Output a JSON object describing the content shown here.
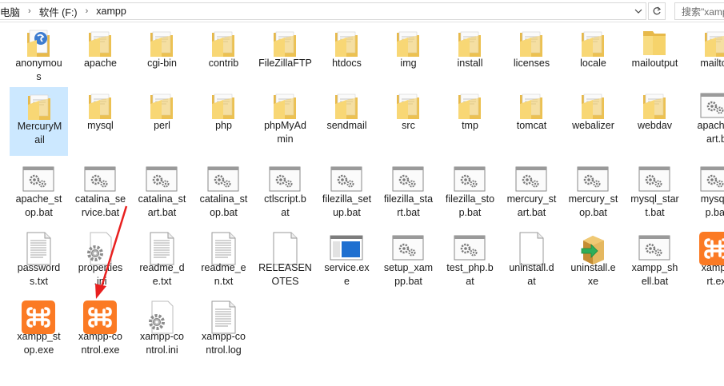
{
  "breadcrumb": [
    "电脑",
    "软件 (F:)",
    "xampp"
  ],
  "search": {
    "placeholder": "搜索\"xampp\""
  },
  "files": [
    {
      "name": "anonymous",
      "label": "anonymou\ns",
      "icon": "folder-simplenote",
      "col": 0,
      "row": 0
    },
    {
      "name": "apache",
      "label": "apache",
      "icon": "folder-docs",
      "col": 1,
      "row": 0
    },
    {
      "name": "cgi-bin",
      "label": "cgi-bin",
      "icon": "folder-docs",
      "col": 2,
      "row": 0
    },
    {
      "name": "contrib",
      "label": "contrib",
      "icon": "folder-docs",
      "col": 3,
      "row": 0
    },
    {
      "name": "FileZillaFTP",
      "label": "FileZillaFTP",
      "icon": "folder-docs",
      "col": 4,
      "row": 0
    },
    {
      "name": "htdocs",
      "label": "htdocs",
      "icon": "folder-docs",
      "col": 5,
      "row": 0
    },
    {
      "name": "img",
      "label": "img",
      "icon": "folder-docs",
      "col": 6,
      "row": 0
    },
    {
      "name": "install",
      "label": "install",
      "icon": "folder-docs",
      "col": 7,
      "row": 0
    },
    {
      "name": "licenses",
      "label": "licenses",
      "icon": "folder-docs",
      "col": 8,
      "row": 0
    },
    {
      "name": "locale",
      "label": "locale",
      "icon": "folder-docs",
      "col": 9,
      "row": 0
    },
    {
      "name": "mailoutput",
      "label": "mailoutput",
      "icon": "folder-empty",
      "col": 10,
      "row": 0
    },
    {
      "name": "mailtodisk",
      "label": "mailtod",
      "icon": "folder-docs",
      "col": 11,
      "row": 0
    },
    {
      "name": "MercuryMail",
      "label": "MercuryM\nail",
      "icon": "folder-docs",
      "col": 0,
      "row": 1,
      "selected": true
    },
    {
      "name": "mysql",
      "label": "mysql",
      "icon": "folder-docs",
      "col": 1,
      "row": 1
    },
    {
      "name": "perl",
      "label": "perl",
      "icon": "folder-docs",
      "col": 2,
      "row": 1
    },
    {
      "name": "php",
      "label": "php",
      "icon": "folder-docs",
      "col": 3,
      "row": 1
    },
    {
      "name": "phpMyAdmin",
      "label": "phpMyAd\nmin",
      "icon": "folder-docs",
      "col": 4,
      "row": 1
    },
    {
      "name": "sendmail",
      "label": "sendmail",
      "icon": "folder-docs",
      "col": 5,
      "row": 1
    },
    {
      "name": "src",
      "label": "src",
      "icon": "folder-docs",
      "col": 6,
      "row": 1
    },
    {
      "name": "tmp",
      "label": "tmp",
      "icon": "folder-docs",
      "col": 7,
      "row": 1
    },
    {
      "name": "tomcat",
      "label": "tomcat",
      "icon": "folder-docs",
      "col": 8,
      "row": 1
    },
    {
      "name": "webalizer",
      "label": "webalizer",
      "icon": "folder-docs",
      "col": 9,
      "row": 1
    },
    {
      "name": "webdav",
      "label": "webdav",
      "icon": "folder-docs",
      "col": 10,
      "row": 1
    },
    {
      "name": "apache_start.bat",
      "label": "apache_\nart.b",
      "icon": "bat",
      "col": 11,
      "row": 1
    },
    {
      "name": "apache_stop.bat",
      "label": "apache_st\nop.bat",
      "icon": "bat",
      "col": 0,
      "row": 2
    },
    {
      "name": "catalina_service.bat",
      "label": "catalina_se\nrvice.bat",
      "icon": "bat",
      "col": 1,
      "row": 2
    },
    {
      "name": "catalina_start.bat",
      "label": "catalina_st\nart.bat",
      "icon": "bat",
      "col": 2,
      "row": 2
    },
    {
      "name": "catalina_stop.bat",
      "label": "catalina_st\nop.bat",
      "icon": "bat",
      "col": 3,
      "row": 2
    },
    {
      "name": "ctlscript.bat",
      "label": "ctlscript.b\nat",
      "icon": "bat",
      "col": 4,
      "row": 2
    },
    {
      "name": "filezilla_setup.bat",
      "label": "filezilla_set\nup.bat",
      "icon": "bat",
      "col": 5,
      "row": 2
    },
    {
      "name": "filezilla_start.bat",
      "label": "filezilla_sta\nrt.bat",
      "icon": "bat",
      "col": 6,
      "row": 2
    },
    {
      "name": "filezilla_stop.bat",
      "label": "filezilla_sto\np.bat",
      "icon": "bat",
      "col": 7,
      "row": 2
    },
    {
      "name": "mercury_start.bat",
      "label": "mercury_st\nart.bat",
      "icon": "bat",
      "col": 8,
      "row": 2
    },
    {
      "name": "mercury_stop.bat",
      "label": "mercury_st\nop.bat",
      "icon": "bat",
      "col": 9,
      "row": 2
    },
    {
      "name": "mysql_start.bat",
      "label": "mysql_star\nt.bat",
      "icon": "bat",
      "col": 10,
      "row": 2
    },
    {
      "name": "mysql_stop.bat",
      "label": "mysql_\np.bat",
      "icon": "bat",
      "col": 11,
      "row": 2
    },
    {
      "name": "passwords.txt",
      "label": "password\ns.txt",
      "icon": "txt",
      "col": 0,
      "row": 3
    },
    {
      "name": "properties.ini",
      "label": "properties\n.ini",
      "icon": "ini",
      "col": 1,
      "row": 3
    },
    {
      "name": "readme_de.txt",
      "label": "readme_d\ne.txt",
      "icon": "txt",
      "col": 2,
      "row": 3
    },
    {
      "name": "readme_en.txt",
      "label": "readme_e\nn.txt",
      "icon": "txt",
      "col": 3,
      "row": 3
    },
    {
      "name": "RELEASENOTES",
      "label": "RELEASEN\nOTES",
      "icon": "blank",
      "col": 4,
      "row": 3
    },
    {
      "name": "service.exe",
      "label": "service.ex\ne",
      "icon": "exe-window",
      "col": 5,
      "row": 3
    },
    {
      "name": "setup_xampp.bat",
      "label": "setup_xam\npp.bat",
      "icon": "bat",
      "col": 6,
      "row": 3
    },
    {
      "name": "test_php.bat",
      "label": "test_php.b\nat",
      "icon": "bat",
      "col": 7,
      "row": 3
    },
    {
      "name": "uninstall.dat",
      "label": "uninstall.d\nat",
      "icon": "blank",
      "col": 8,
      "row": 3
    },
    {
      "name": "uninstall.exe",
      "label": "uninstall.e\nxe",
      "icon": "installer",
      "col": 9,
      "row": 3
    },
    {
      "name": "xampp_shell.bat",
      "label": "xampp_sh\nell.bat",
      "icon": "bat",
      "col": 10,
      "row": 3
    },
    {
      "name": "xampp_start.exe",
      "label": "xampp\nrt.ex",
      "icon": "xampp",
      "col": 11,
      "row": 3
    },
    {
      "name": "xampp_stop.exe",
      "label": "xampp_st\nop.exe",
      "icon": "xampp",
      "col": 0,
      "row": 4
    },
    {
      "name": "xampp-control.exe",
      "label": "xampp-co\nntrol.exe",
      "icon": "xampp",
      "col": 1,
      "row": 4
    },
    {
      "name": "xampp-control.ini",
      "label": "xampp-co\nntrol.ini",
      "icon": "ini",
      "col": 2,
      "row": 4
    },
    {
      "name": "xampp-control.log",
      "label": "xampp-co\nntrol.log",
      "icon": "txt",
      "col": 3,
      "row": 4
    }
  ],
  "colors": {
    "folder": "#f6d36b",
    "selection": "#cce8ff",
    "xampp": "#fb7a24",
    "arrow": "#e8201f"
  }
}
